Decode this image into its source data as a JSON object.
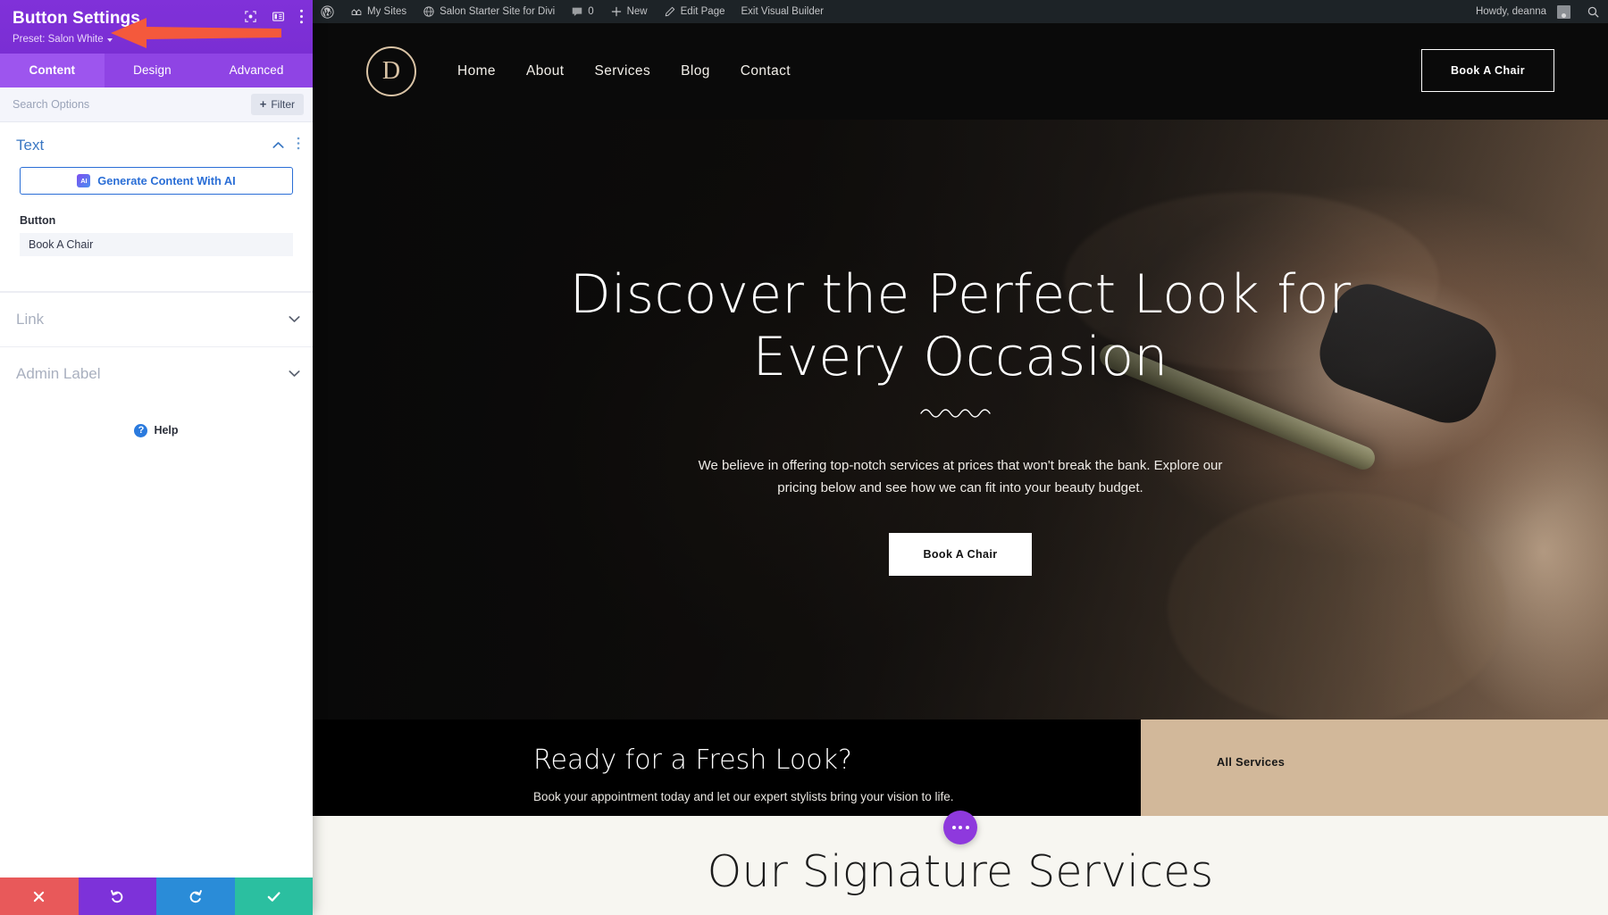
{
  "panel": {
    "title": "Button Settings",
    "preset_label": "Preset: Salon White",
    "header_icons": [
      "target-icon",
      "layout-panel-icon",
      "more-vertical-icon"
    ],
    "tabs": [
      {
        "label": "Content",
        "active": true
      },
      {
        "label": "Design",
        "active": false
      },
      {
        "label": "Advanced",
        "active": false
      }
    ],
    "search_placeholder": "Search Options",
    "search_value": "",
    "filter_label": "Filter",
    "sections": {
      "text": {
        "title": "Text",
        "ai_button_label": "Generate Content With AI",
        "ai_badge": "AI",
        "field_label": "Button",
        "field_value": "Book A Chair"
      },
      "link": {
        "title": "Link"
      },
      "admin_label": {
        "title": "Admin Label"
      }
    },
    "help_label": "Help",
    "actions": [
      {
        "name": "cancel",
        "icon": "close-icon",
        "color": "#e8595a"
      },
      {
        "name": "undo",
        "icon": "undo-icon",
        "color": "#7d32d9"
      },
      {
        "name": "redo",
        "icon": "redo-icon",
        "color": "#2a8cd8"
      },
      {
        "name": "save",
        "icon": "check-icon",
        "color": "#2bbfa0"
      }
    ]
  },
  "adminbar": {
    "items": [
      {
        "label": "",
        "icon": "wordpress-logo-icon"
      },
      {
        "label": "My Sites",
        "icon": "sites-icon"
      },
      {
        "label": "Salon Starter Site for Divi",
        "icon": "site-icon"
      },
      {
        "label": "0",
        "icon": "comment-icon"
      },
      {
        "label": "New",
        "icon": "plus-icon"
      },
      {
        "label": "Edit Page",
        "icon": "pencil-icon"
      },
      {
        "label": "Exit Visual Builder",
        "icon": ""
      }
    ],
    "howdy": "Howdy, deanna",
    "search_icon": "search-icon"
  },
  "site": {
    "logo_letter": "D",
    "nav": [
      "Home",
      "About",
      "Services",
      "Blog",
      "Contact"
    ],
    "header_cta": "Book A Chair",
    "hero": {
      "title_line1": "Discover the Perfect Look for",
      "title_line2": "Every Occasion",
      "divider": "wave-divider-icon",
      "subtitle": "We believe in offering top-notch services at prices that won't break the bank. Explore our pricing below and see how we can fit into your beauty budget.",
      "cta": "Book A Chair"
    },
    "cta_band": {
      "heading": "Ready for a Fresh Look?",
      "subtext": "Book your appointment today and let our expert stylists bring your vision to life.",
      "side_link": "All Services"
    },
    "services": {
      "title": "Our Signature Services",
      "fab_icon": "more-horizontal-icon"
    }
  },
  "colors": {
    "panel_purple": "#7b2fd6",
    "tab_purple": "#9d55ee",
    "accent_blue": "#2a6ed6",
    "tan": "#d2b89a",
    "logo_tan": "#d9c3a5",
    "arrow_red": "#f4593c"
  }
}
